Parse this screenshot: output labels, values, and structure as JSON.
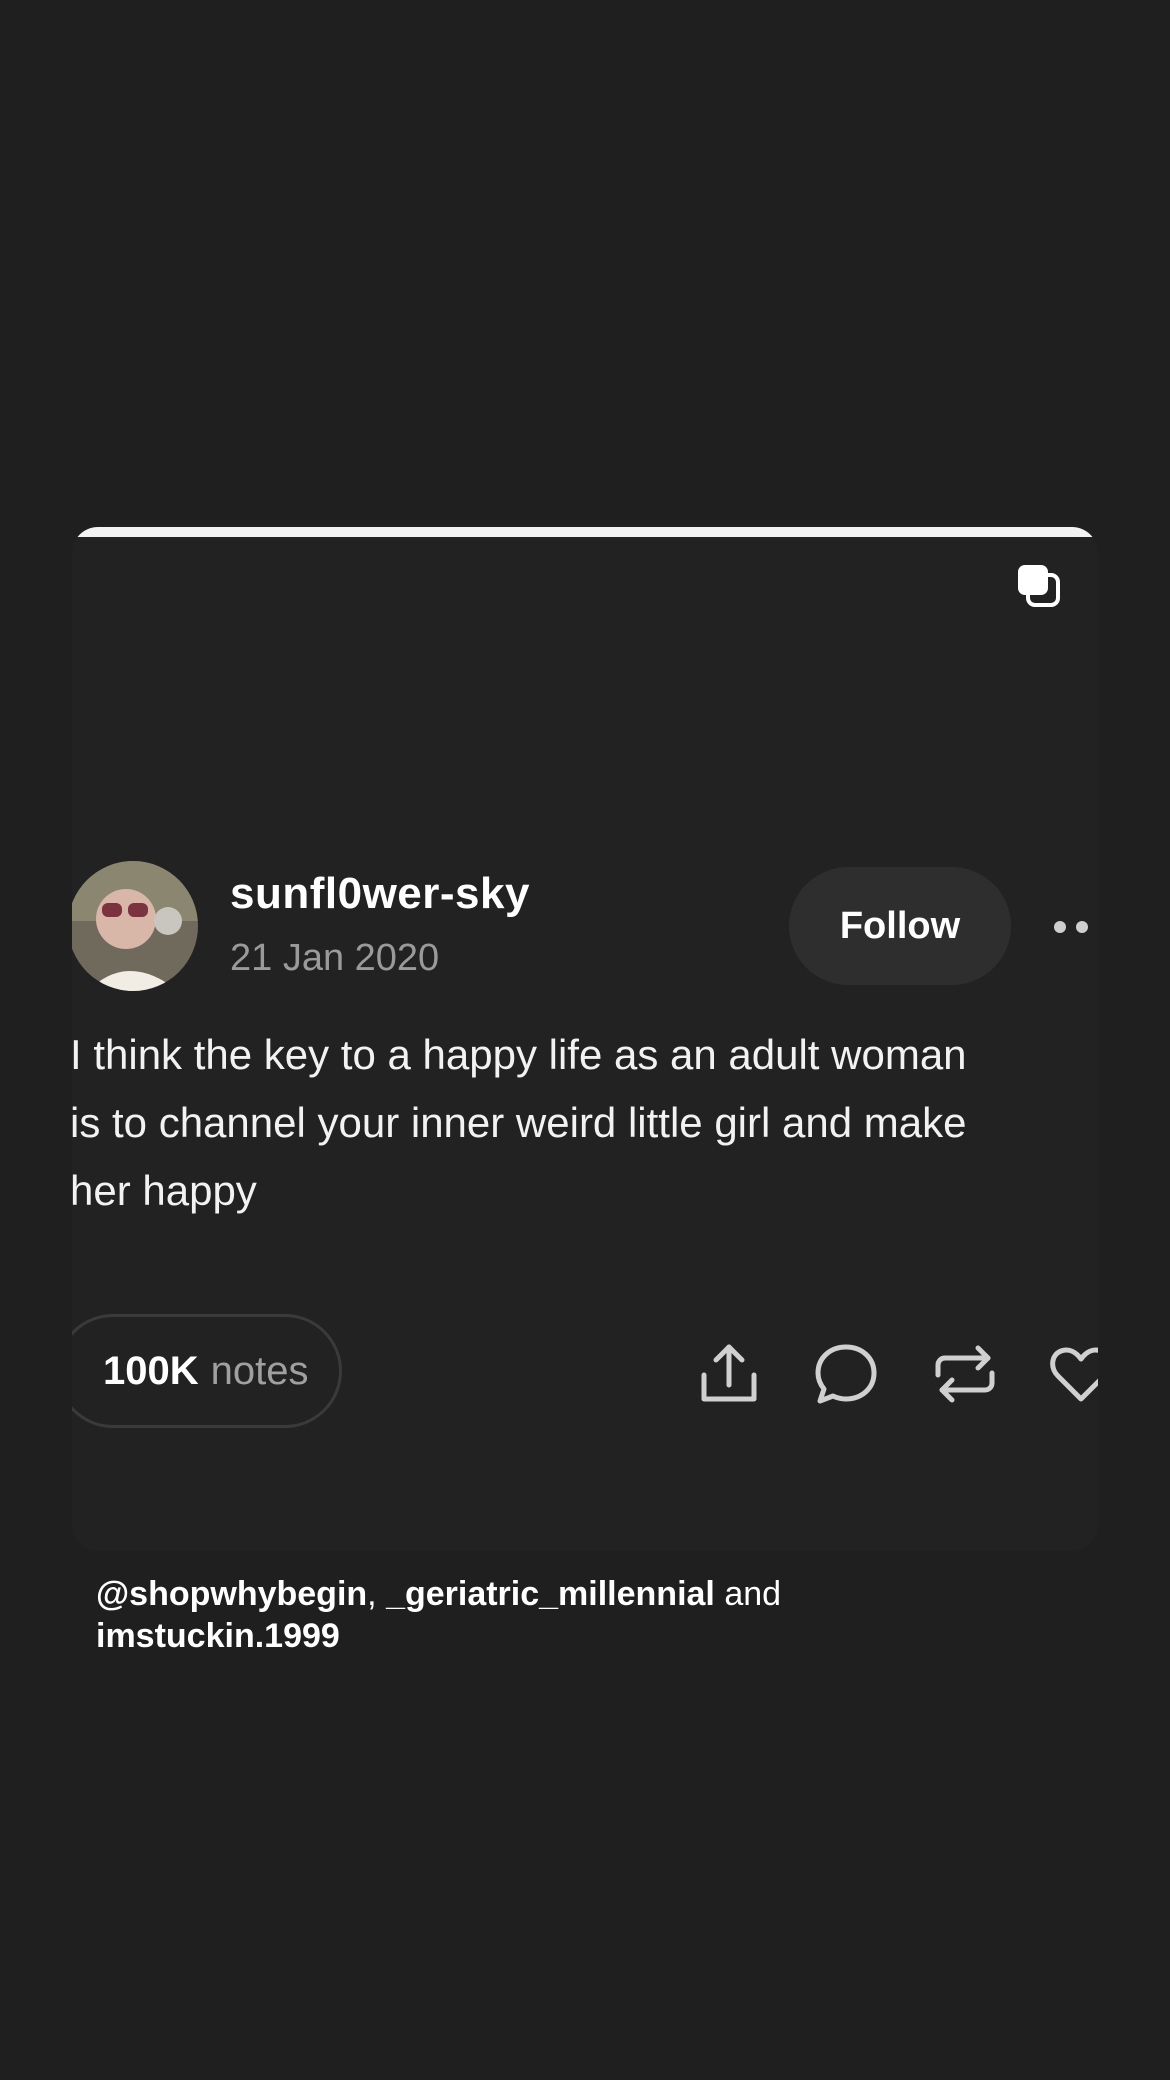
{
  "post": {
    "username": "sunfl0wer-sky",
    "date": "21 Jan 2020",
    "follow_label": "Follow",
    "text": "I think the key to a happy life as an adult woman\nis to channel your inner weird little girl and make\nher happy",
    "notes_count": "100K",
    "notes_label": "notes"
  },
  "caption": {
    "mention_1": "@shopwhybegin",
    "separator": ", ",
    "mention_2": "_geriatric_millennial",
    "conjunction": " and",
    "mention_3": "imstuckin.1999"
  },
  "icons": {
    "top_right": "multiple-images-icon",
    "more": "more-options-icon",
    "share": "share-icon",
    "comment": "comment-icon",
    "reblog": "reblog-icon",
    "like": "heart-icon"
  }
}
